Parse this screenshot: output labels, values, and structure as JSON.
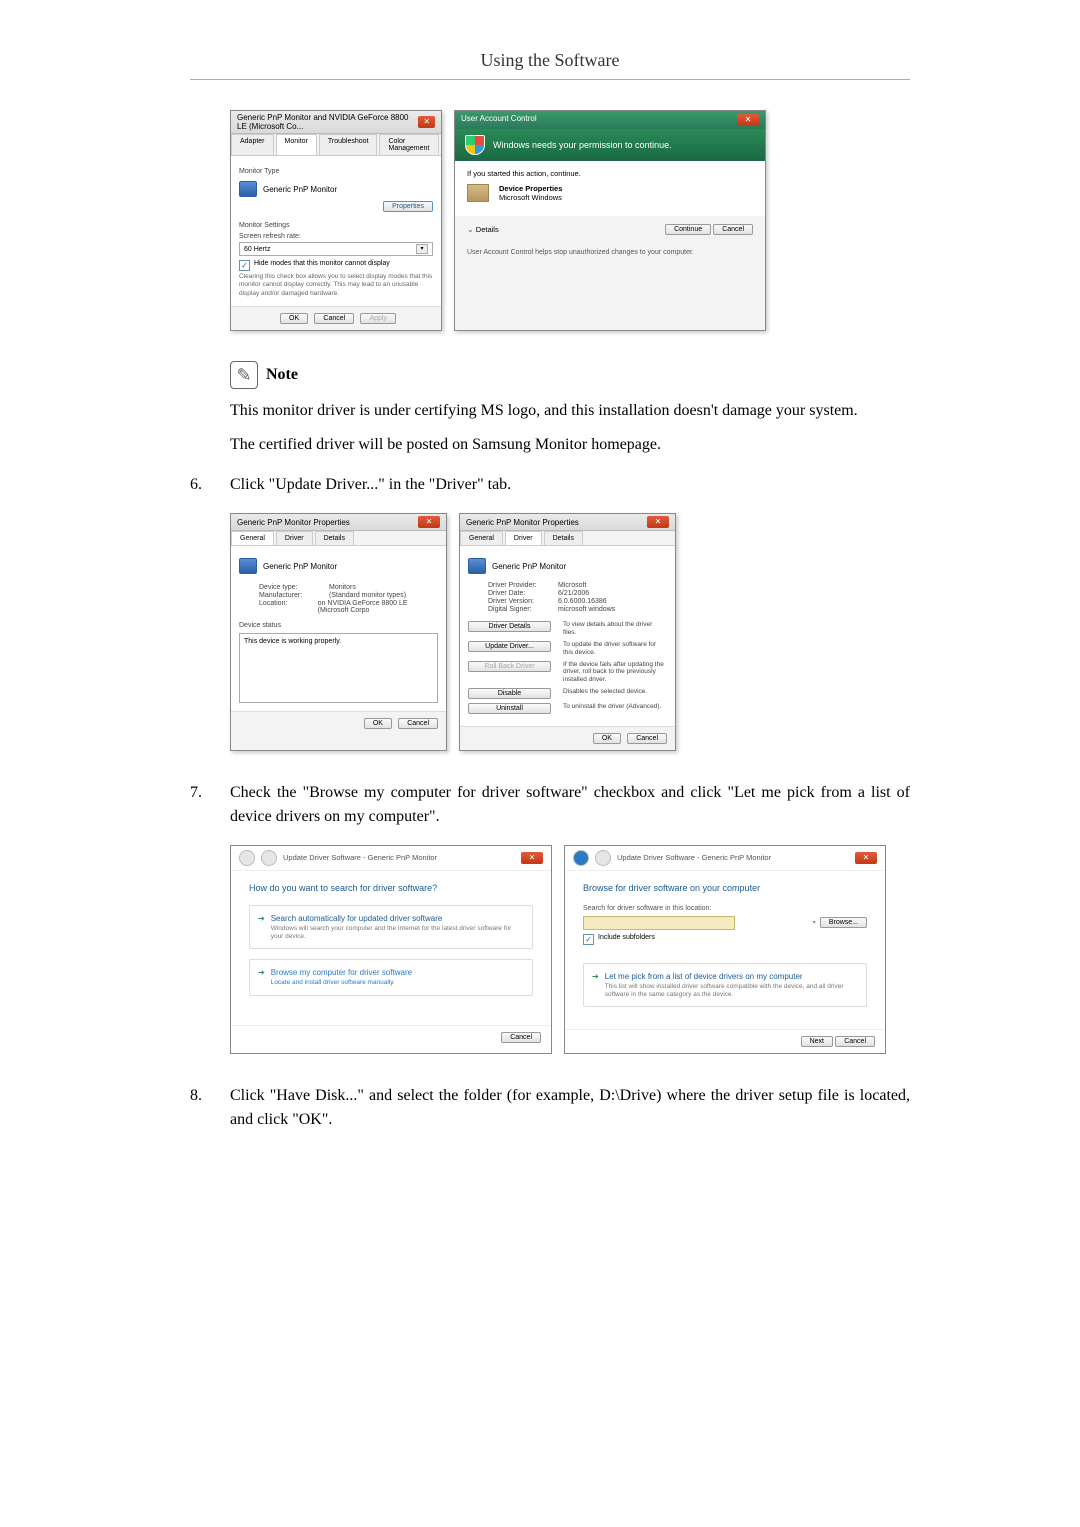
{
  "header": {
    "title": "Using the Software"
  },
  "monitor_props": {
    "title": "Generic PnP Monitor and NVIDIA GeForce 8800 LE (Microsoft Co...",
    "tabs": [
      "Adapter",
      "Monitor",
      "Troubleshoot",
      "Color Management"
    ],
    "monitor_type_label": "Monitor Type",
    "monitor_name": "Generic PnP Monitor",
    "properties_btn": "Properties",
    "settings_label": "Monitor Settings",
    "refresh_label": "Screen refresh rate:",
    "refresh_value": "60 Hertz",
    "hide_modes_checked": true,
    "hide_modes": "Hide modes that this monitor cannot display",
    "hide_modes_note": "Clearing this check box allows you to select display modes that this monitor cannot display correctly. This may lead to an unusable display and/or damaged hardware.",
    "ok": "OK",
    "cancel": "Cancel",
    "apply": "Apply"
  },
  "uac": {
    "title": "User Account Control",
    "headline": "Windows needs your permission to continue.",
    "started": "If you started this action, continue.",
    "program": "Device Properties",
    "publisher": "Microsoft Windows",
    "details": "Details",
    "continue": "Continue",
    "cancel": "Cancel",
    "footer": "User Account Control helps stop unauthorized changes to your computer."
  },
  "note": {
    "label": "Note",
    "text1": "This monitor driver is under certifying MS logo, and this installation doesn't damage your system.",
    "text2": "The certified driver will be posted on Samsung Monitor homepage."
  },
  "steps": {
    "s6": "Click \"Update Driver...\" in the \"Driver\" tab.",
    "s7": "Check the \"Browse my computer for driver software\" checkbox and click \"Let me pick from a list of device drivers on my computer\".",
    "s8": "Click \"Have Disk...\" and select the folder (for example, D:\\Drive) where the driver setup file is located, and click \"OK\"."
  },
  "gen_props": {
    "title": "Generic PnP Monitor Properties",
    "tabs": [
      "General",
      "Driver",
      "Details"
    ],
    "name": "Generic PnP Monitor",
    "device_type_k": "Device type:",
    "device_type_v": "Monitors",
    "manufacturer_k": "Manufacturer:",
    "manufacturer_v": "(Standard monitor types)",
    "location_k": "Location:",
    "location_v": "on NVIDIA GeForce 8800 LE (Microsoft Corpo",
    "status_label": "Device status",
    "status_text": "This device is working properly.",
    "ok": "OK",
    "cancel": "Cancel"
  },
  "driver_props": {
    "title": "Generic PnP Monitor Properties",
    "tabs": [
      "General",
      "Driver",
      "Details"
    ],
    "name": "Generic PnP Monitor",
    "provider_k": "Driver Provider:",
    "provider_v": "Microsoft",
    "date_k": "Driver Date:",
    "date_v": "6/21/2006",
    "version_k": "Driver Version:",
    "version_v": "6.0.6000.16386",
    "signer_k": "Digital Signer:",
    "signer_v": "microsoft windows",
    "details_btn": "Driver Details",
    "details_desc": "To view details about the driver files.",
    "update_btn": "Update Driver...",
    "update_desc": "To update the driver software for this device.",
    "rollback_btn": "Roll Back Driver",
    "rollback_desc": "If the device fails after updating the driver, roll back to the previously installed driver.",
    "disable_btn": "Disable",
    "disable_desc": "Disables the selected device.",
    "uninstall_btn": "Uninstall",
    "uninstall_desc": "To uninstall the driver (Advanced).",
    "ok": "OK",
    "cancel": "Cancel"
  },
  "wizard1": {
    "crumb": "Update Driver Software - Generic PnP Monitor",
    "question": "How do you want to search for driver software?",
    "opt1_title": "Search automatically for updated driver software",
    "opt1_desc": "Windows will search your computer and the Internet for the latest driver software for your device.",
    "opt2_title": "Browse my computer for driver software",
    "opt2_desc": "Locate and install driver software manually.",
    "cancel": "Cancel"
  },
  "wizard2": {
    "crumb": "Update Driver Software - Generic PnP Monitor",
    "heading": "Browse for driver software on your computer",
    "search_label": "Search for driver software in this location:",
    "browse": "Browse...",
    "include": "Include subfolders",
    "opt_title": "Let me pick from a list of device drivers on my computer",
    "opt_desc": "This list will show installed driver software compatible with the device, and all driver software in the same category as the device.",
    "next": "Next",
    "cancel": "Cancel"
  }
}
